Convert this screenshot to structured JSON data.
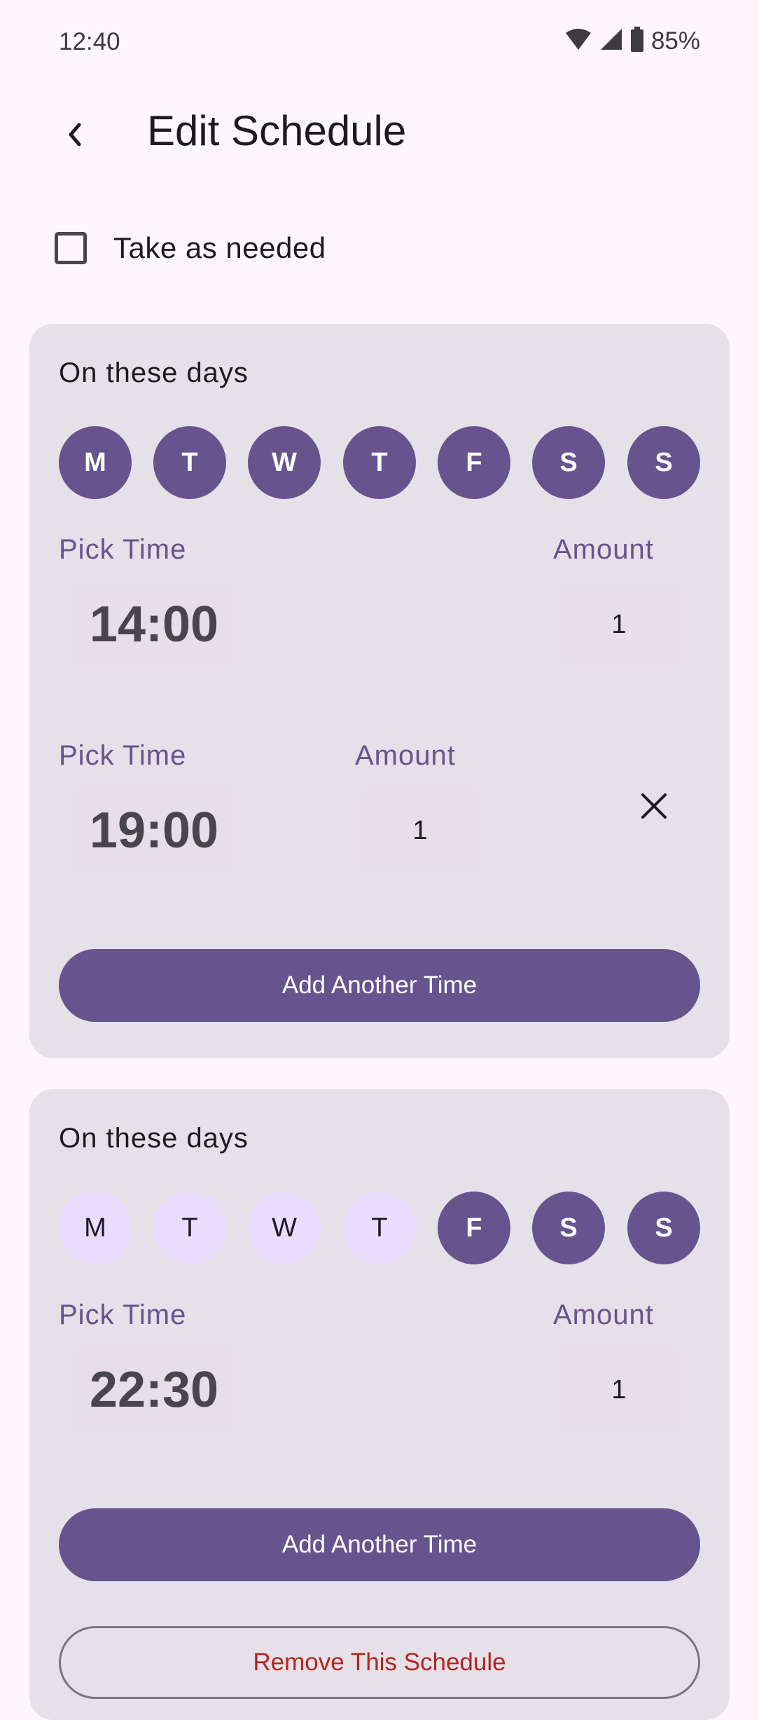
{
  "status_bar": {
    "time": "12:40",
    "battery": "85%"
  },
  "header": {
    "title": "Edit Schedule"
  },
  "as_needed": {
    "label": "Take as needed",
    "checked": false
  },
  "schedules": [
    {
      "title": "On these days",
      "days": [
        {
          "label": "M",
          "selected": true
        },
        {
          "label": "T",
          "selected": true
        },
        {
          "label": "W",
          "selected": true
        },
        {
          "label": "T",
          "selected": true
        },
        {
          "label": "F",
          "selected": true
        },
        {
          "label": "S",
          "selected": true
        },
        {
          "label": "S",
          "selected": true
        }
      ],
      "times": [
        {
          "pick_label": "Pick Time",
          "time": "14:00",
          "amount_label": "Amount",
          "amount": "1"
        },
        {
          "pick_label": "Pick Time",
          "time": "19:00",
          "amount_label": "Amount",
          "amount": "1"
        }
      ],
      "add_label": "Add Another Time"
    },
    {
      "title": "On these days",
      "days": [
        {
          "label": "M",
          "selected": false
        },
        {
          "label": "T",
          "selected": false
        },
        {
          "label": "W",
          "selected": false
        },
        {
          "label": "T",
          "selected": false
        },
        {
          "label": "F",
          "selected": true
        },
        {
          "label": "S",
          "selected": true
        },
        {
          "label": "S",
          "selected": true
        }
      ],
      "times": [
        {
          "pick_label": "Pick Time",
          "time": "22:30",
          "amount_label": "Amount",
          "amount": "1"
        }
      ],
      "add_label": "Add Another Time",
      "remove_label": "Remove This Schedule"
    }
  ],
  "colors": {
    "primary": "#67548e",
    "card": "#e6e0e8",
    "day_off": "#e9ddff",
    "danger": "#b3261e"
  },
  "icons": [
    "wifi-icon",
    "signal-icon",
    "battery-icon",
    "back-arrow-icon",
    "close-icon"
  ]
}
